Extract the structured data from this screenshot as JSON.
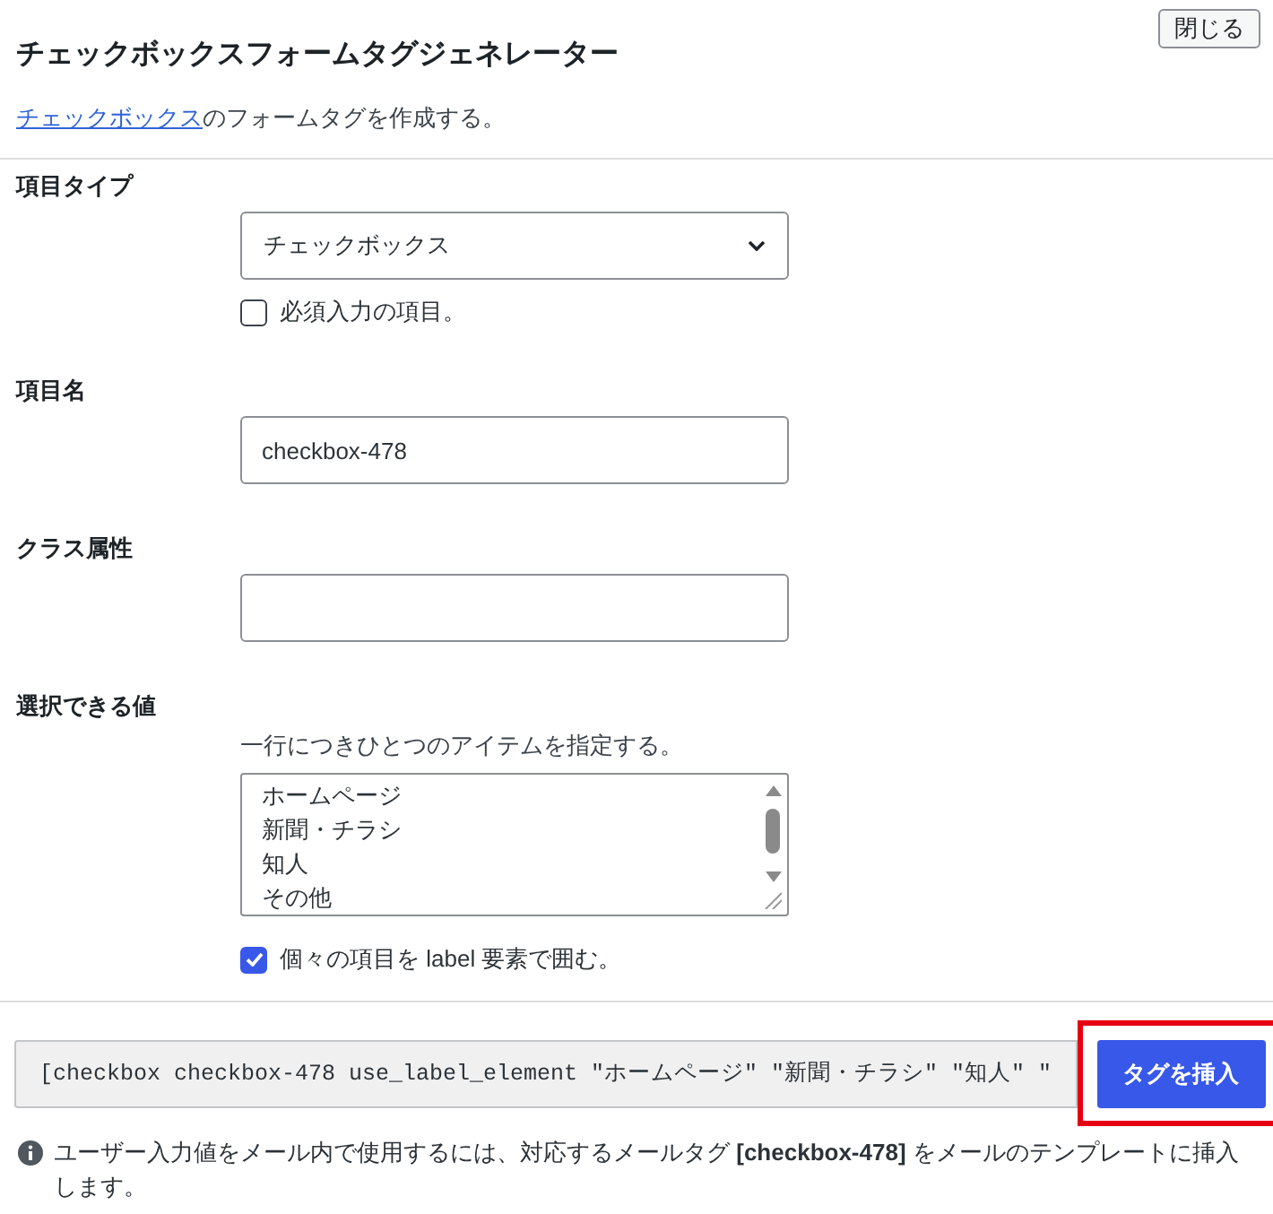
{
  "dialog": {
    "title": "チェックボックスフォームタグジェネレーター",
    "close_button": "閉じる"
  },
  "description": {
    "link": "チェックボックス",
    "rest": "のフォームタグを作成する。"
  },
  "fields": [
    {
      "kind": "select",
      "label": "項目タイプ",
      "value": "チェックボックス",
      "option": {
        "label": "必須入力の項目。",
        "checked": false
      }
    },
    {
      "kind": "text",
      "label": "項目名",
      "value": "checkbox-478"
    },
    {
      "kind": "text",
      "label": "クラス属性"
    },
    {
      "kind": "textarea",
      "label": "選択できる値",
      "hint": "一行につきひとつのアイテムを指定する。",
      "lines": [
        "ホームページ",
        "新聞・チラシ",
        "知人",
        "その他"
      ],
      "option": {
        "label": "個々の項目を label 要素で囲む。",
        "checked": true
      }
    }
  ],
  "insert_box": {
    "tag": "[checkbox checkbox-478 use_label_element \"ホームページ\" \"新聞・チラシ\" \"知人\" \"",
    "button": {
      "label": "タグを挿入",
      "highlighted": true
    }
  },
  "note": "ユーザー入力値をメール内で使用するには、対応するメールタグ **[checkbox-478]** をメールのテンプレートに挿入します。"
}
